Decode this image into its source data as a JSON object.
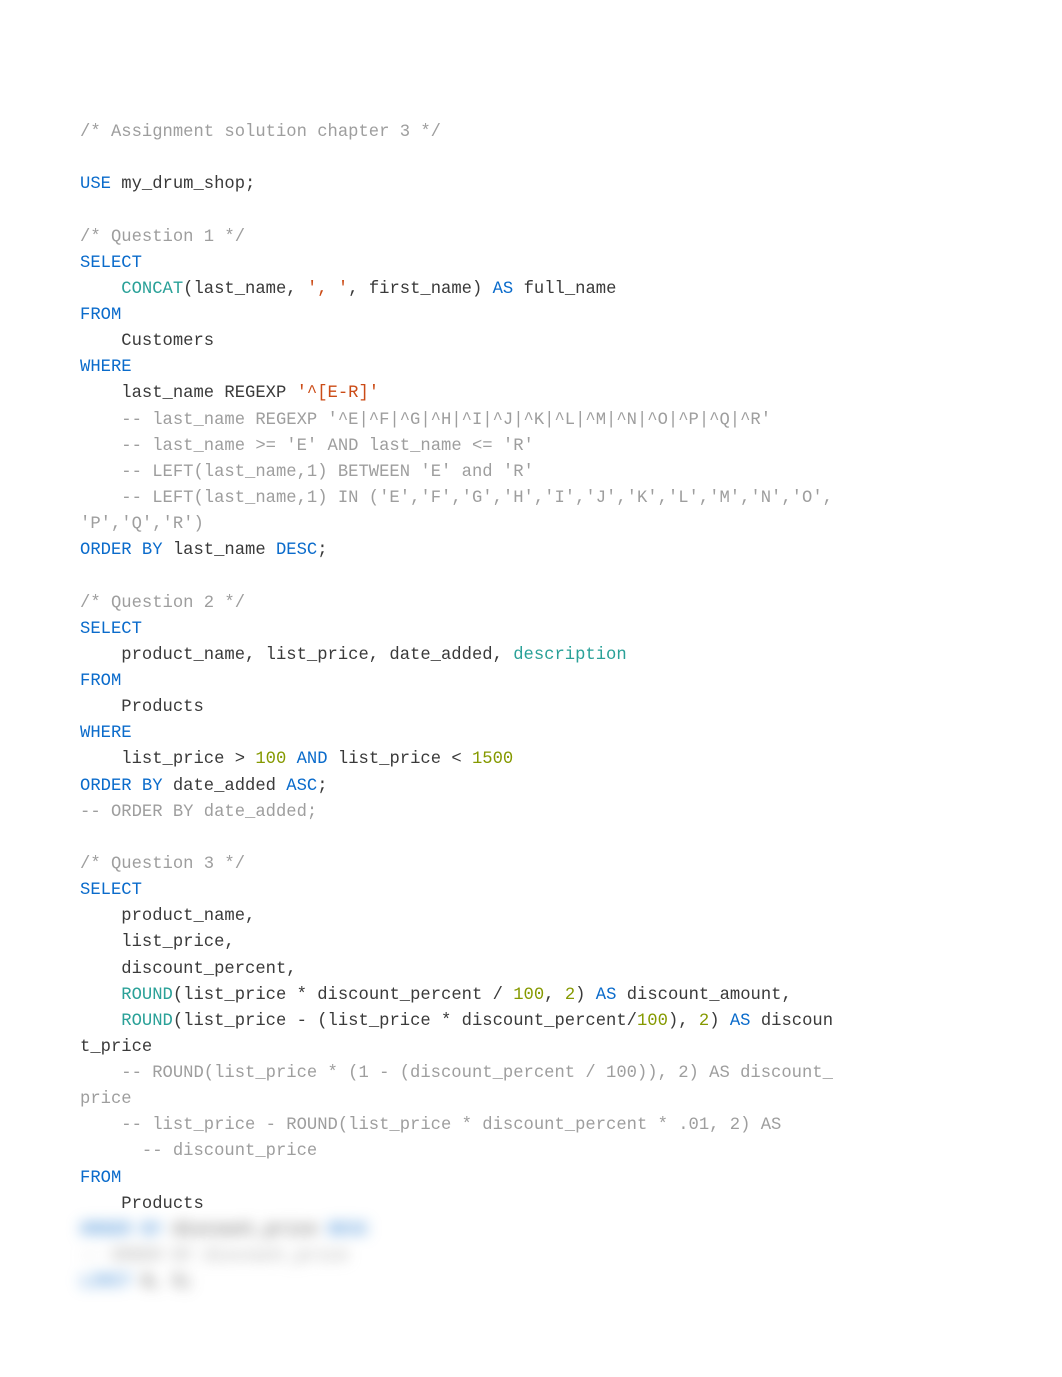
{
  "l": {
    "c1": "/* Assignment solution chapter 3 */",
    "use": "USE",
    "use2": " my_drum_shop;",
    "q1c": "/* Question 1 */",
    "sel": "SELECT",
    "indent": "    ",
    "concat": "CONCAT",
    "p1": "(last_name, ",
    "s1": "', '",
    "p2": ", first_name) ",
    "as": "AS",
    "p3": " full_name",
    "from": "FROM",
    "cust": "    Customers",
    "where": "WHERE",
    "ln1a": "    last_name REGEXP ",
    "ln1b": "'^[E-R]'",
    "cr2": "    -- last_name REGEXP '^E|^F|^G|^H|^I|^J|^K|^L|^M|^N|^O|^P|^Q|^R'",
    "cr3a": "    ",
    "cr3b": "-- last_name >= 'E' AND last_name <= 'R'",
    "cr4a": "    ",
    "cr4b": "-- LEFT(last_name,1) BETWEEN 'E' and 'R'",
    "cr5a": "    ",
    "cr5b": "-- LEFT(last_name,1) IN ('E','F','G','H','I','J','K','L','M','N','O',",
    "cr6": "'P','Q','R')",
    "ob": "ORDER BY ",
    "ob1": "last_name ",
    "desc": "DESC",
    "semi": ";",
    "q2c": "/* Question 2 */",
    "q2l1a": "    product_name, list_price, date_added, ",
    "desc2": "description",
    "prod": "    Products",
    "q2w1": "    list_price > ",
    "n100": "100",
    "and": " AND ",
    "q2w2": "list_price < ",
    "n1500": "1500",
    "ob2": "date_added ",
    "asc": "ASC",
    "cob": "-- ORDER BY date_added;",
    "q3c": "/* Question 3 */",
    "q3l1": "    product_name,",
    "q3l2": "    list_price,",
    "q3l3": "    discount_percent,",
    "round": "ROUND",
    "q3r1a": "(list_price * discount_percent / ",
    "q3r1c": ", ",
    "n2": "2",
    "q3r1d": ") ",
    "q3r1e": " discount_amount,",
    "q3r2a": "(list_price - (list_price * discount_percent/",
    "q3r2c": "), ",
    "q3r2d": ") ",
    "q3r2e": " discoun",
    "q3r3": "t_price",
    "c3a": "    -- ROUND(list_price * (1 - (discount_percent / 100)), 2) AS discount_",
    "c3b": "price",
    "c3c": "    -- list_price - ROUND(list_price * discount_percent * .01, 2) AS ",
    "c3d": "      -- discount_price",
    "bl1a": "ORDER BY",
    "bl1b": " discount_pri",
    "bl1c": "ce ",
    "bl1d": "DESC",
    "bl2": "-- ORDER BY discount_price",
    "bl3a": "LIMIT",
    "bl3b": " 0, 5;"
  }
}
